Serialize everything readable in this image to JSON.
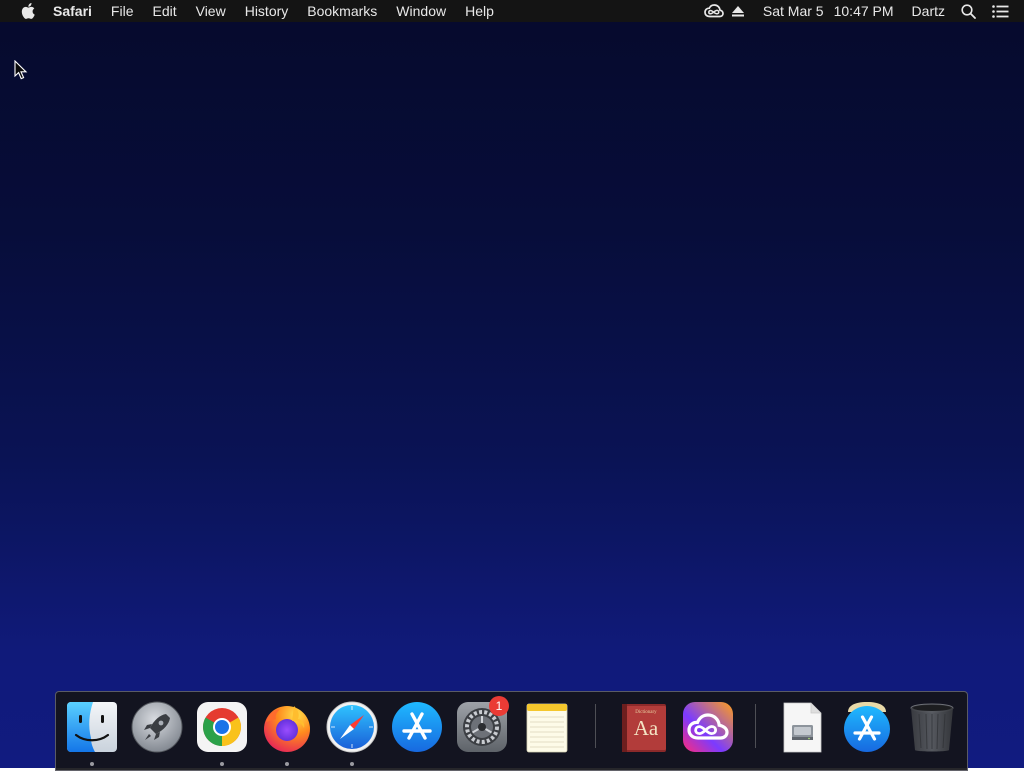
{
  "menubar": {
    "app_name": "Safari",
    "menus": [
      "File",
      "Edit",
      "View",
      "History",
      "Bookmarks",
      "Window",
      "Help"
    ],
    "date": "Sat Mar 5",
    "time": "10:47 PM",
    "user": "Dartz"
  },
  "dock": {
    "items": [
      {
        "name": "Finder",
        "icon": "finder-icon",
        "running": true
      },
      {
        "name": "Launchpad",
        "icon": "launchpad-icon",
        "running": false
      },
      {
        "name": "Google Chrome",
        "icon": "chrome-icon",
        "running": true
      },
      {
        "name": "Firefox",
        "icon": "firefox-icon",
        "running": true
      },
      {
        "name": "Safari",
        "icon": "safari-icon",
        "running": true
      },
      {
        "name": "App Store",
        "icon": "app-store-icon",
        "running": false
      },
      {
        "name": "System Preferences",
        "icon": "system-preferences-icon",
        "running": false,
        "badge": "1"
      },
      {
        "name": "Notes",
        "icon": "notes-icon",
        "running": false
      },
      {
        "name": "Dictionary",
        "icon": "dictionary-icon",
        "running": false
      },
      {
        "name": "Adobe Creative Cloud",
        "icon": "creative-cloud-icon",
        "running": false
      },
      {
        "name": "Installer Document",
        "icon": "document-icon",
        "running": false
      },
      {
        "name": "App Store Downloads",
        "icon": "app-store-download-icon",
        "running": false
      },
      {
        "name": "Trash",
        "icon": "trash-icon",
        "running": false
      }
    ],
    "dictionary_glyph": "Aa",
    "system_preferences_badge": "1"
  },
  "colors": {
    "menubar_bg": "#141414",
    "desktop_top": "#060a2c",
    "desktop_bottom": "#111b80",
    "badge": "#ea3b35"
  }
}
